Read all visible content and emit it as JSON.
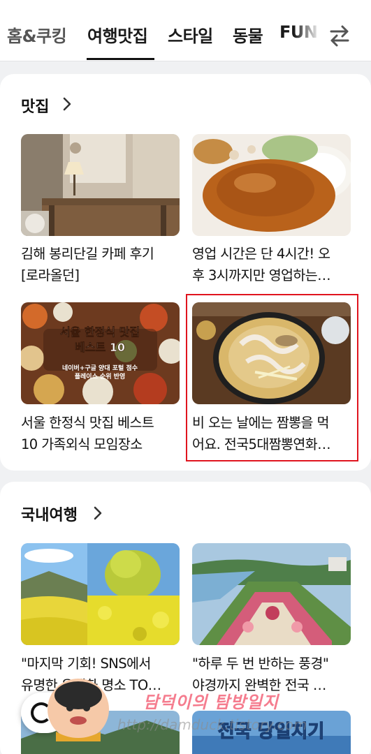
{
  "tabs": [
    {
      "label": "홈&쿠킹",
      "active": false
    },
    {
      "label": "여행맛집",
      "active": true
    },
    {
      "label": "스타일",
      "active": false
    },
    {
      "label": "동물",
      "active": false
    },
    {
      "label": "FUN",
      "active": false
    }
  ],
  "icons": {
    "swap": "swap-arrows-icon",
    "chevron": "chevron-right-icon",
    "search": "search-fab-icon"
  },
  "sections": [
    {
      "title": "맛집",
      "items": [
        {
          "line1": "김해 봉리단길 카페 후기",
          "line2": "[로라올던]",
          "image": "cafe-interior-photo"
        },
        {
          "line1": "영업 시간은 단 4시간! 오",
          "line2": "후 3시까지만 영업하는…",
          "image": "pork-cutlet-photo"
        },
        {
          "line1": "서울 한정식 맛집 베스트",
          "line2": "10 가족외식 모임장소",
          "image": "korean-table-photo",
          "overlay": {
            "title_line1": "서울 한정식 맛집",
            "title_line2": "베스트 10",
            "sub_line1": "네이버+구글 양대 포털 점수",
            "sub_line2": "플레이스 순위 반영"
          }
        },
        {
          "line1": "비 오는 날에는 짬뽕을 먹",
          "line2": "어요. 전국5대짬뽕연화…",
          "image": "jjamppong-photo",
          "highlighted": true
        }
      ]
    },
    {
      "title": "국내여행",
      "items": [
        {
          "line1": "\"마지막 기회! SNS에서",
          "line2": "유명한 유채화 명소 TO…",
          "image": "canola-field-photo"
        },
        {
          "line1": "\"하루 두 번 반하는 풍경\"",
          "line2": "야경까지 완벽한 전국 …",
          "image": "garden-aerial-photo"
        }
      ]
    }
  ],
  "watermark": {
    "title": "담덕이의 탐방일지",
    "url": "http://damduck.tistory.com"
  },
  "partial_thumb_text": "전국 당일치기",
  "colors": {
    "highlight": "#e0141e",
    "background": "#f0f1f3",
    "watermark": "#f57c8e"
  }
}
